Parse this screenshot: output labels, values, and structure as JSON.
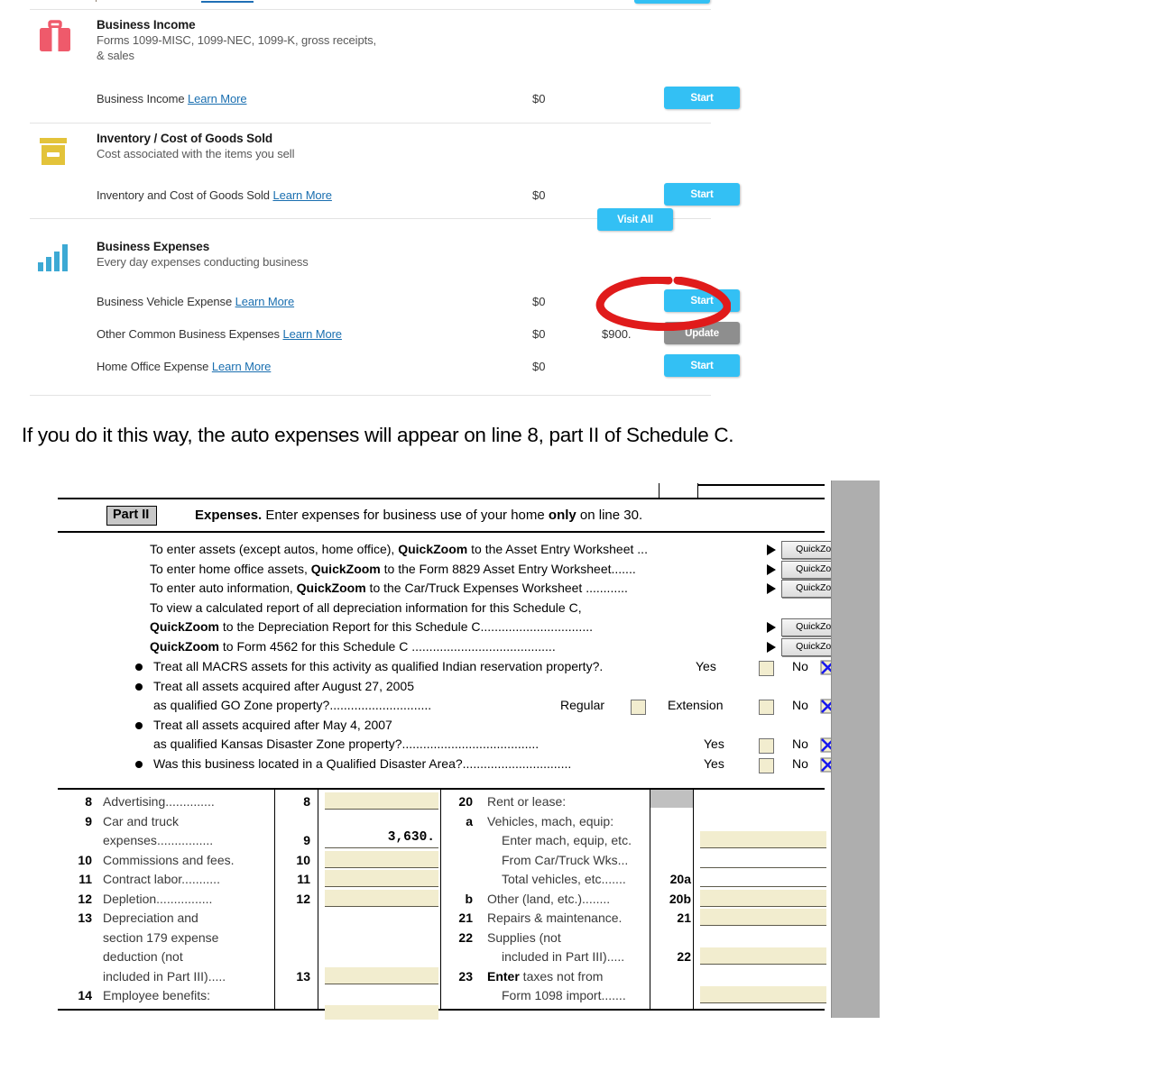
{
  "turbotax": {
    "sections": [
      {
        "icon": "briefcase-icon",
        "title": "Business Income",
        "subtitle_line1": "Forms 1099-MISC, 1099-NEC, 1099-K, gross receipts,",
        "subtitle_line2": "& sales",
        "rows": [
          {
            "label": "Business Income",
            "learn_more": "Learn More",
            "amount1": "$0",
            "amount2": "",
            "button": "Start",
            "button_style": "blue"
          }
        ],
        "header_button": ""
      },
      {
        "icon": "archive-box-icon",
        "title": "Inventory / Cost of Goods Sold",
        "subtitle_line1": "Cost associated with the items you sell",
        "subtitle_line2": "",
        "rows": [
          {
            "label": "Inventory and Cost of Goods Sold",
            "learn_more": "Learn More",
            "amount1": "$0",
            "amount2": "",
            "button": "Start",
            "button_style": "blue"
          }
        ],
        "header_button": ""
      },
      {
        "icon": "bar-chart-icon",
        "title": "Business Expenses",
        "subtitle_line1": "Every day expenses conducting business",
        "subtitle_line2": "",
        "header_button": "Visit All",
        "rows": [
          {
            "label": "Business Vehicle Expense",
            "learn_more": "Learn More",
            "amount1": "$0",
            "amount2": "",
            "button": "Start",
            "button_style": "blue"
          },
          {
            "label": "Other Common Business Expenses",
            "learn_more": "Learn More",
            "amount1": "$0",
            "amount2": "$900.",
            "button": "Update",
            "button_style": "gray"
          },
          {
            "label": "Home Office Expense",
            "learn_more": "Learn More",
            "amount1": "$0",
            "amount2": "",
            "button": "Start",
            "button_style": "blue"
          }
        ]
      }
    ]
  },
  "caption": "If you do it this way, the auto expenses will appear on line 8, part II of Schedule C.",
  "form": {
    "part_badge": "Part II",
    "part_title_bold": "Expenses.",
    "part_title_rest_1": " Enter expenses for business use of your home ",
    "part_title_bold_2": "only",
    "part_title_rest_2": " on line 30.",
    "quickzoom_label": "QuickZoom",
    "quickzoom_lines": [
      {
        "pre": "To enter assets (except autos, home office), ",
        "bold": "QuickZoom",
        "post": " to the Asset Entry Worksheet",
        "dots": "...",
        "has_button": true
      },
      {
        "pre": "To enter home office assets, ",
        "bold": "QuickZoom",
        "post": " to the Form 8829 Asset Entry Worksheet",
        "dots": ".......",
        "has_button": true
      },
      {
        "pre": "To enter auto information, ",
        "bold": "QuickZoom",
        "post": " to the Car/Truck Expenses Worksheet",
        "dots": "............",
        "has_button": true
      },
      {
        "pre": "To view a calculated report of all depreciation information for this Schedule C,",
        "bold": "",
        "post": "",
        "dots": "",
        "has_button": false
      },
      {
        "pre": "",
        "bold": "QuickZoom",
        "post": " to the Depreciation Report for this Schedule C",
        "dots": "................................",
        "has_button": true
      },
      {
        "pre": "",
        "bold": "QuickZoom",
        "post": " to Form 4562 for this Schedule C",
        "dots": ".........................................",
        "has_button": true
      }
    ],
    "bullet_questions": [
      {
        "lines": [
          {
            "text": "Treat all MACRS assets for this activity as qualified Indian reservation property?.",
            "bullet": true,
            "dots": ""
          }
        ],
        "option_left_label": "Yes",
        "option_mid_label": "",
        "no_label": "No",
        "checked": "no"
      },
      {
        "lines": [
          {
            "text": "Treat all assets acquired after August 27, 2005",
            "bullet": true,
            "dots": ""
          },
          {
            "text": "as qualified GO Zone property?",
            "bullet": false,
            "dots": "............................."
          }
        ],
        "option_left_label": "Regular",
        "option_mid_label": "Extension",
        "no_label": "No",
        "checked": "no"
      },
      {
        "lines": [
          {
            "text": "Treat all assets acquired after May 4, 2007",
            "bullet": true,
            "dots": ""
          },
          {
            "text": "as qualified Kansas Disaster Zone property?",
            "bullet": false,
            "dots": "......................................."
          }
        ],
        "option_left_label": "Yes",
        "option_mid_label": "",
        "no_label": "No",
        "checked": "no"
      },
      {
        "lines": [
          {
            "text": "Was this business located in a Qualified Disaster Area?",
            "bullet": true,
            "dots": "..............................."
          }
        ],
        "option_left_label": "Yes",
        "option_mid_label": "",
        "no_label": "No",
        "checked": "no"
      }
    ],
    "expense_table": {
      "left_items": [
        {
          "no": "8",
          "text": "Advertising",
          "dots": "..............",
          "field_no": "8",
          "value": "",
          "filled": true
        },
        {
          "no": "9",
          "text": "Car and truck",
          "dots": "",
          "field_no": "",
          "value": "",
          "filled": false
        },
        {
          "no": "",
          "text": "expenses",
          "dots": "................",
          "field_no": "9",
          "value": "3,630.",
          "filled": false
        },
        {
          "no": "10",
          "text": "Commissions and fees.",
          "dots": "",
          "field_no": "10",
          "value": "",
          "filled": true
        },
        {
          "no": "11",
          "text": "Contract labor",
          "dots": "...........",
          "field_no": "11",
          "value": "",
          "filled": true
        },
        {
          "no": "12",
          "text": "Depletion",
          "dots": "................",
          "field_no": "12",
          "value": "",
          "filled": true
        },
        {
          "no": "13",
          "text": "Depreciation and",
          "dots": "",
          "field_no": "",
          "value": "",
          "filled": false
        },
        {
          "no": "",
          "text": "section 179 expense",
          "dots": "",
          "field_no": "",
          "value": "",
          "filled": false
        },
        {
          "no": "",
          "text": "deduction (not",
          "dots": "",
          "field_no": "",
          "value": "",
          "filled": false
        },
        {
          "no": "",
          "text": "included in Part III)",
          "dots": ".....",
          "field_no": "13",
          "value": "",
          "filled": true
        },
        {
          "no": "14",
          "text": "Employee benefits:",
          "dots": "",
          "field_no": "",
          "value": "",
          "filled": false
        }
      ],
      "right_items": [
        {
          "no": "20",
          "text": "Rent or lease:",
          "dots": "",
          "field_no": "",
          "value": "",
          "filled": false
        },
        {
          "no": "a",
          "text": "Vehicles, mach, equip:",
          "dots": "",
          "field_no": "",
          "value": "",
          "filled": false
        },
        {
          "no": "",
          "text": "Enter mach, equip, etc.",
          "dots": "",
          "field_no": "",
          "value": "",
          "filled": true
        },
        {
          "no": "",
          "text": "From Car/Truck Wks",
          "dots": "...",
          "field_no": "",
          "value": "",
          "filled": false
        },
        {
          "no": "",
          "text": "Total vehicles, etc.",
          "dots": "......",
          "field_no": "20a",
          "value": "",
          "filled": false
        },
        {
          "no": "b",
          "text": "Other (land, etc.)",
          "dots": "........",
          "field_no": "20b",
          "value": "",
          "filled": true
        },
        {
          "no": "21",
          "text": "Repairs & maintenance.",
          "dots": "",
          "field_no": "21",
          "value": "",
          "filled": true
        },
        {
          "no": "22",
          "text": "Supplies (not",
          "dots": "",
          "field_no": "",
          "value": "",
          "filled": false
        },
        {
          "no": "",
          "text": "included in Part III)",
          "dots": ".....",
          "field_no": "22",
          "value": "",
          "filled": true
        },
        {
          "no": "23",
          "text_bold": "Enter",
          "text": " taxes not from",
          "dots": "",
          "field_no": "",
          "value": "",
          "filled": false
        },
        {
          "no": "",
          "text": "Form 1098 import",
          "dots": ".......",
          "field_no": "",
          "value": "",
          "filled": true
        }
      ]
    }
  },
  "annotation": {
    "type": "hand-drawn-circle",
    "color": "#e01b1b",
    "target": "Start button for Business Vehicle Expense"
  },
  "colors": {
    "button_blue": "#33c0f4",
    "button_gray": "#8e8e8e",
    "link_blue": "#1a6fb0",
    "icon_pink": "#ef5a6b",
    "icon_yellow": "#e3c33a",
    "icon_blue": "#3da9d4",
    "field_cream": "#f2edcf",
    "scrollbar_gray": "#aeaeae",
    "checkbox_x_blue": "#1a1aee"
  }
}
